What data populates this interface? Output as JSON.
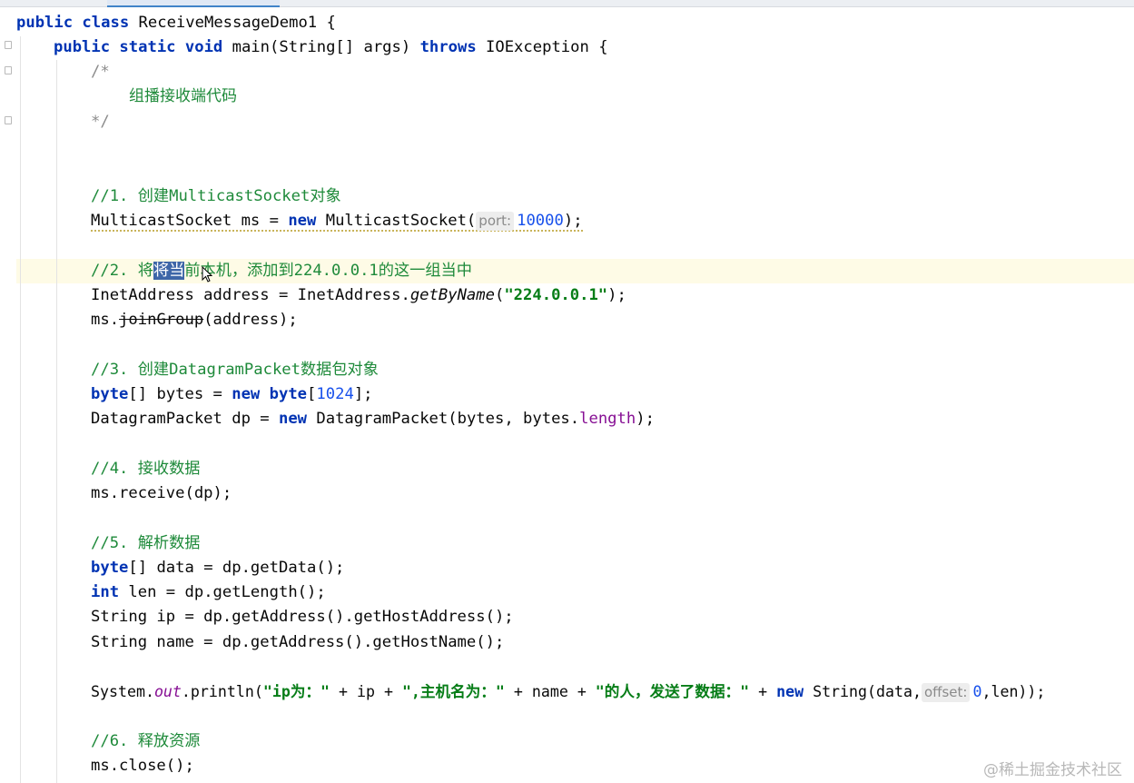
{
  "editor": {
    "lines": {
      "l1": [
        "public class ",
        "ReceiveMessageDemo1 {"
      ],
      "l2": [
        "public static void ",
        "main(String[] args) ",
        "throws ",
        "IOException {"
      ],
      "l3": "/*",
      "l4": "组播接收端代码",
      "l5": "*/",
      "l6": "//1. 创建MulticastSocket对象",
      "l7": [
        "MulticastSocket ms = ",
        "new ",
        "MulticastSocket(",
        "port:",
        "10000",
        ");"
      ],
      "l8": [
        "//2. 将",
        "将当",
        "前本机，添加到224.0.0.1的这一组当中"
      ],
      "l9": [
        "InetAddress address = InetAddress.",
        "getByName",
        "(",
        "\"224.0.0.1\"",
        ");"
      ],
      "l10": [
        "ms.",
        "joinGroup",
        "(address);"
      ],
      "l11": "//3. 创建DatagramPacket数据包对象",
      "l12": [
        "byte",
        "[] bytes = ",
        "new ",
        "byte",
        "[",
        "1024",
        "];"
      ],
      "l13": [
        "DatagramPacket dp = ",
        "new ",
        "DatagramPacket(bytes, bytes.",
        "length",
        ");"
      ],
      "l14": "//4. 接收数据",
      "l15": "ms.receive(dp);",
      "l16": "//5. 解析数据",
      "l17": [
        "byte",
        "[] data = dp.getData();"
      ],
      "l18": [
        "int ",
        "len = dp.getLength();"
      ],
      "l19": "String ip = dp.getAddress().getHostAddress();",
      "l20": "String name = dp.getAddress().getHostName();",
      "l21": [
        "System.",
        "out",
        ".println(",
        "\"ip为：\"",
        " + ip + ",
        "\",主机名为：\"",
        " + name + ",
        "\"的人，发送了数据：\"",
        " + ",
        "new ",
        "String(data,",
        "offset:",
        "0",
        ",len));"
      ],
      "l22": "//6. 释放资源",
      "l23": "ms.close();"
    },
    "icons": {
      "cursor": "text-cursor-pointer-icon",
      "fold": "fold-marker-icon"
    }
  },
  "watermark": "@稀土掘金技术社区",
  "colors": {
    "keyword": "#0033b3",
    "comment": "#8c8c8c",
    "string": "#067d17",
    "number": "#1750eb",
    "field": "#871094",
    "selection": "#3e66a8",
    "caretline": "#fefbe6"
  }
}
